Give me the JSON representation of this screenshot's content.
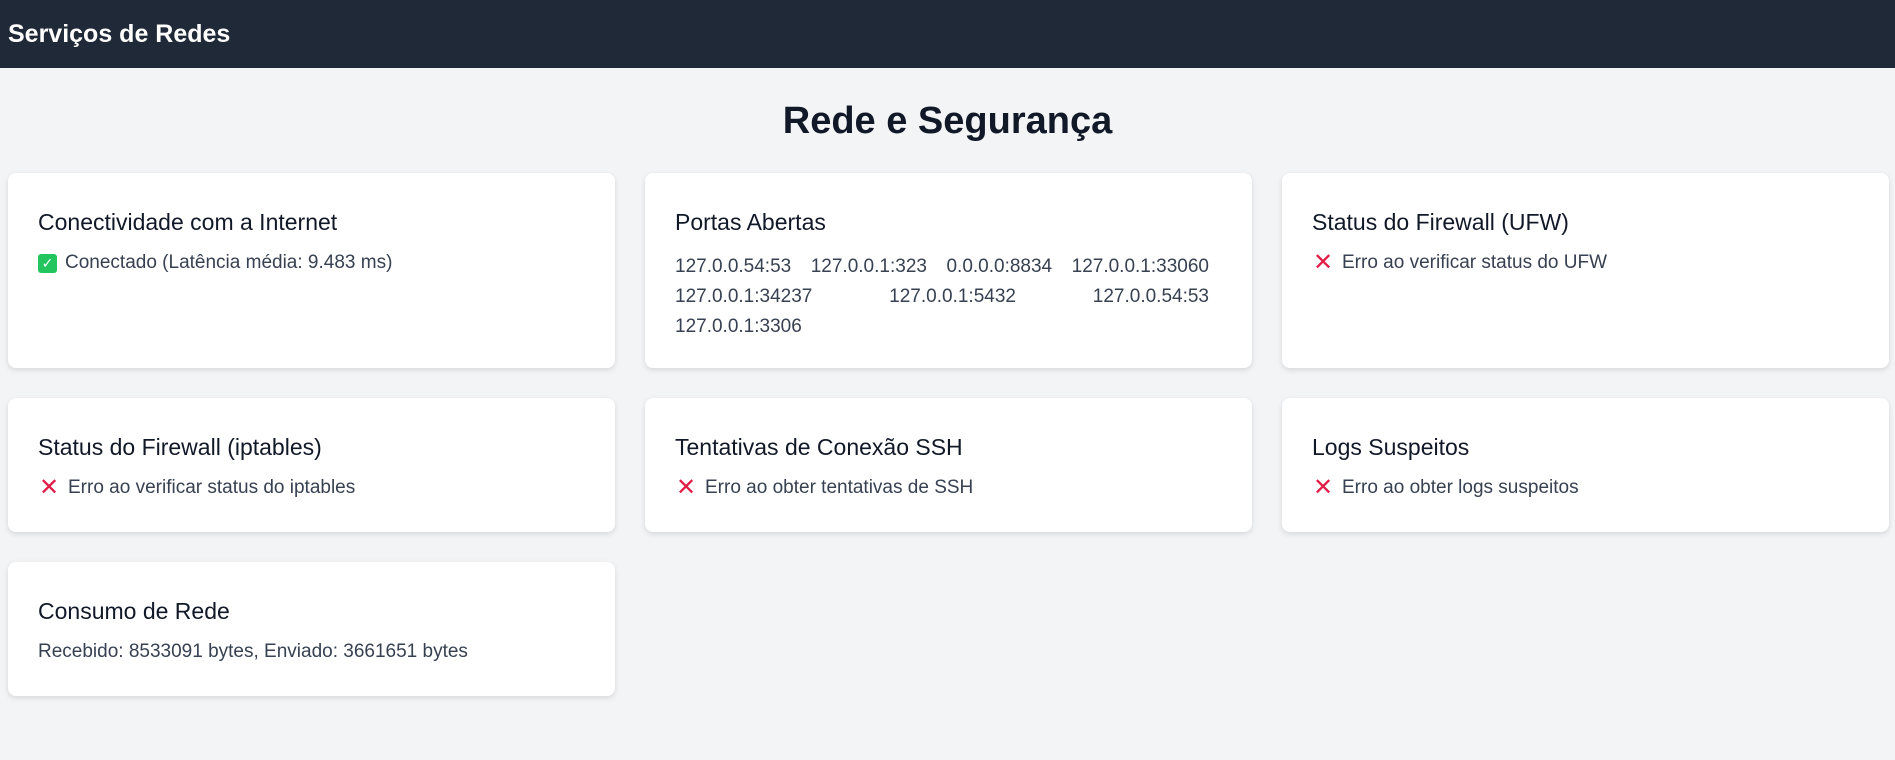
{
  "header": {
    "brand": "Serviços de Redes"
  },
  "page": {
    "title": "Rede e Segurança"
  },
  "cards": {
    "internet": {
      "title": "Conectividade com a Internet",
      "status": "Conectado (Latência média: 9.483 ms)",
      "icon": "check-icon",
      "color": "#22c55e"
    },
    "ports": {
      "title": "Portas Abertas",
      "items": [
        "127.0.0.54:53",
        "127.0.0.1:323",
        "0.0.0.0:8834",
        "127.0.0.1:33060",
        "127.0.0.1:34237",
        "127.0.0.1:5432",
        "127.0.0.54:53",
        "127.0.0.1:3306"
      ]
    },
    "ufw": {
      "title": "Status do Firewall (UFW)",
      "status": "Erro ao verificar status do UFW",
      "icon": "cross-icon",
      "color": "#e11d48"
    },
    "iptables": {
      "title": "Status do Firewall (iptables)",
      "status": "Erro ao verificar status do iptables",
      "icon": "cross-icon",
      "color": "#e11d48"
    },
    "ssh": {
      "title": "Tentativas de Conexão SSH",
      "status": "Erro ao obter tentativas de SSH",
      "icon": "cross-icon",
      "color": "#e11d48"
    },
    "logs": {
      "title": "Logs Suspeitos",
      "status": "Erro ao obter logs suspeitos",
      "icon": "cross-icon",
      "color": "#e11d48"
    },
    "traffic": {
      "title": "Consumo de Rede",
      "status": "Recebido: 8533091 bytes, Enviado: 3661651 bytes"
    }
  }
}
